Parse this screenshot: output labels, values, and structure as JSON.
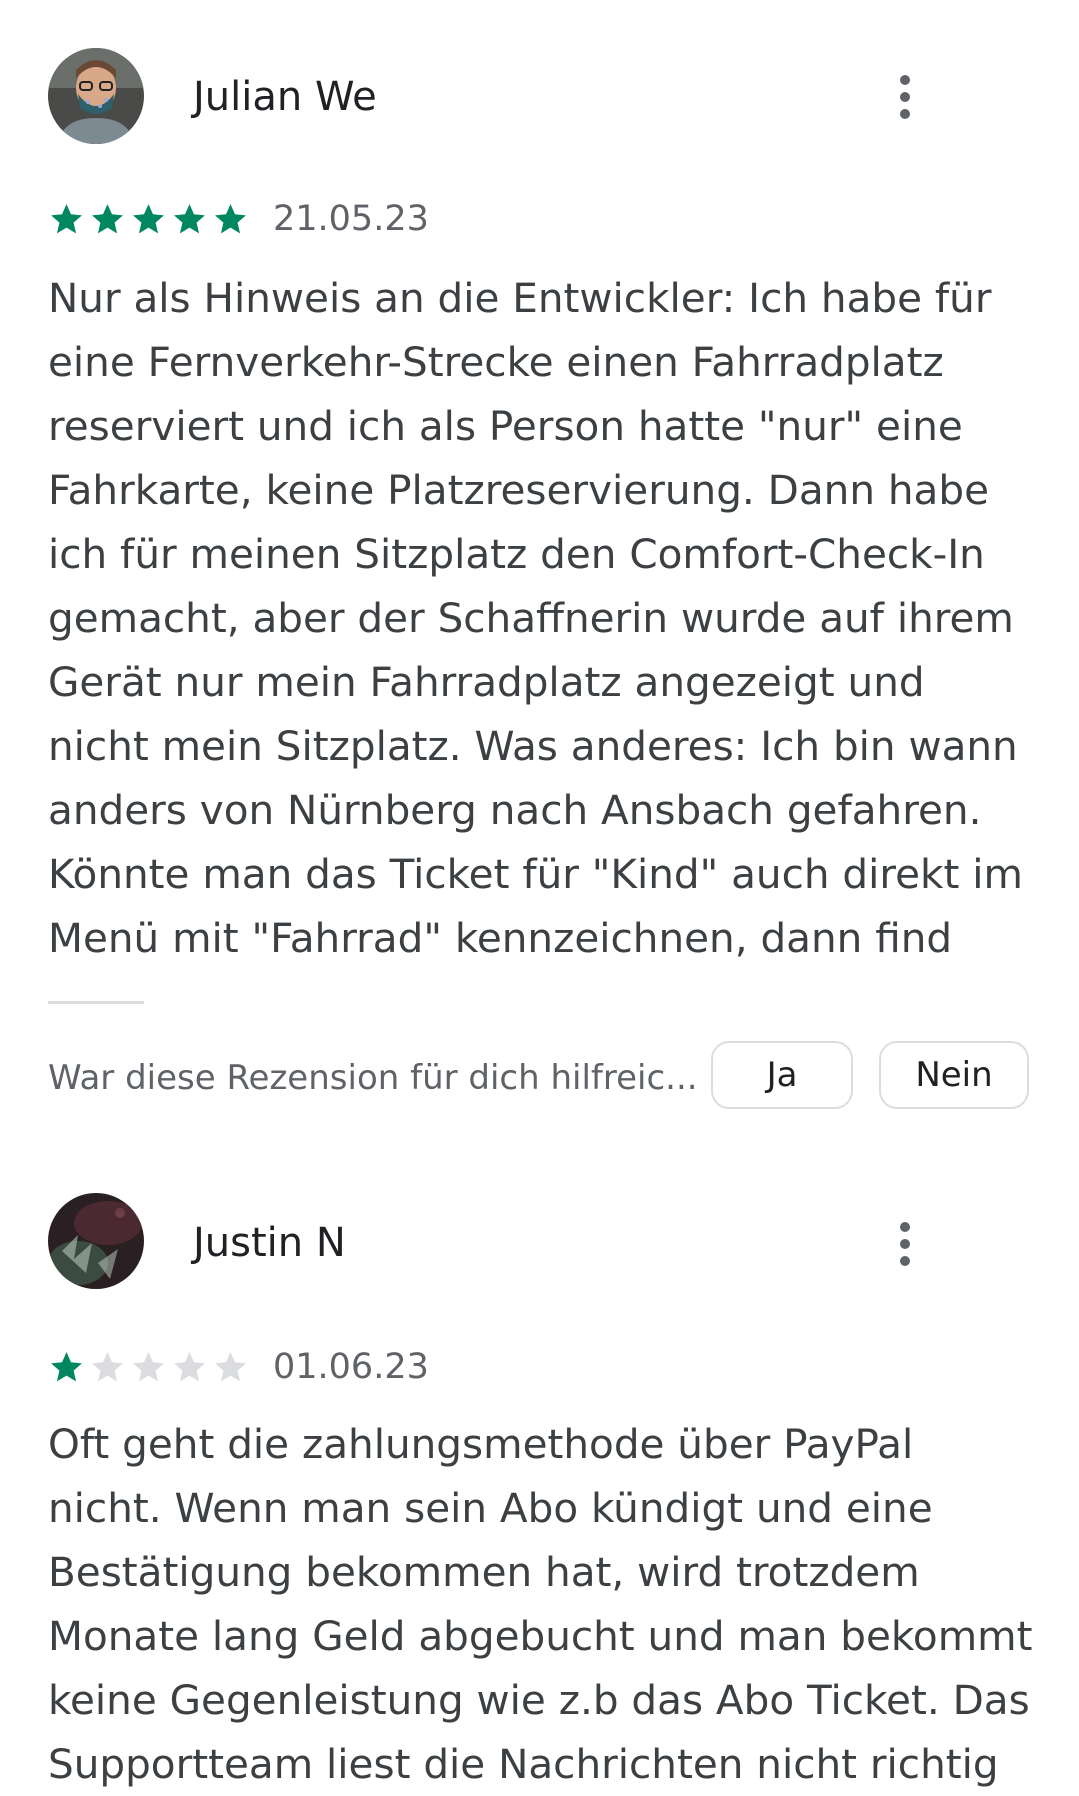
{
  "reviews": [
    {
      "reviewer": "Julian We",
      "avatar_icon": "person-avatar-masked",
      "rating": 5,
      "max_rating": 5,
      "date": "21.05.23",
      "text_lines": [
        "Nur als Hinweis an die Entwickler: Ich habe für",
        "eine Fernverkehr-Strecke einen Fahrradplatz",
        "reserviert und ich als Person hatte \"nur\" eine",
        "Fahrkarte, keine Platzreservierung. Dann habe",
        "ich für meinen Sitzplatz den Comfort-Check-In",
        "gemacht, aber der Schaffnerin wurde auf ihrem",
        "Gerät nur mein Fahrradplatz angezeigt und",
        "nicht mein Sitzplatz. Was anderes: Ich bin wann",
        "anders von Nürnberg nach Ansbach gefahren.",
        "Könnte man das Ticket für \"Kind\" auch direkt im",
        "Menü mit \"Fahrrad\" kennzeichnen, dann find"
      ],
      "helpful_question": "War diese Rezension für dich hilfreic...",
      "yes_label": "Ja",
      "no_label": "Nein"
    },
    {
      "reviewer": "Justin N",
      "avatar_icon": "dark-photo-avatar",
      "rating": 1,
      "max_rating": 5,
      "date": "01.06.23",
      "text_lines": [
        "Oft geht die zahlungsmethode über PayPal",
        "nicht. Wenn man sein Abo kündigt und eine",
        "Bestätigung bekommen hat, wird trotzdem",
        "Monate lang Geld abgebucht und man bekommt",
        "keine Gegenleistung wie z.b das Abo Ticket. Das",
        "Supportteam liest die Nachrichten nicht richtig"
      ]
    }
  ],
  "colors": {
    "star_filled": "#01875f",
    "star_empty": "#dadce0",
    "text": "#3c4043",
    "name": "#202124",
    "secondary": "#5f6368"
  },
  "icons": {
    "more": "more-vert-icon",
    "star": "star-icon"
  }
}
